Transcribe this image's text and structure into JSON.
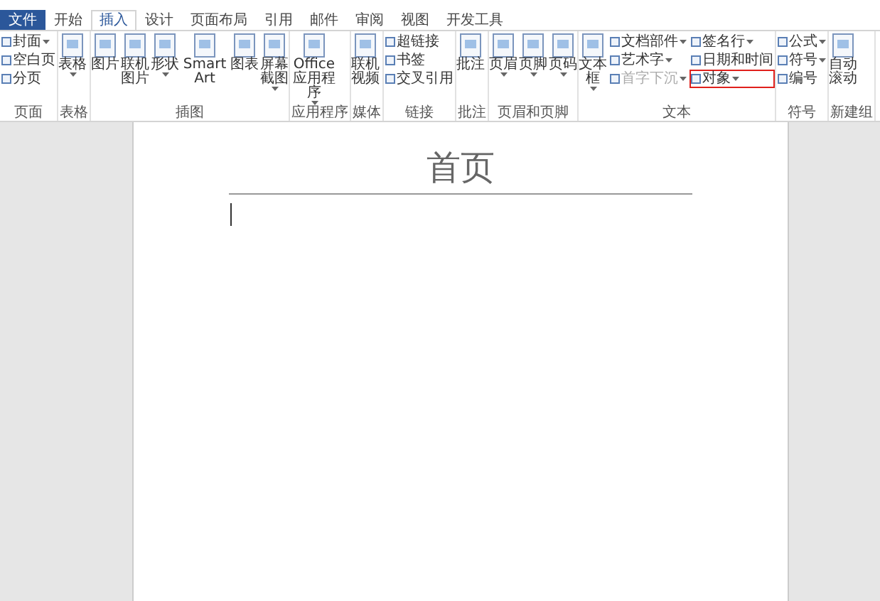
{
  "tabs": [
    {
      "label": "文件",
      "kind": "file",
      "selected": false
    },
    {
      "label": "开始",
      "kind": "tab",
      "selected": false
    },
    {
      "label": "插入",
      "kind": "tab",
      "selected": true
    },
    {
      "label": "设计",
      "kind": "tab",
      "selected": false
    },
    {
      "label": "页面布局",
      "kind": "tab",
      "selected": false
    },
    {
      "label": "引用",
      "kind": "tab",
      "selected": false
    },
    {
      "label": "邮件",
      "kind": "tab",
      "selected": false
    },
    {
      "label": "审阅",
      "kind": "tab",
      "selected": false
    },
    {
      "label": "视图",
      "kind": "tab",
      "selected": false
    },
    {
      "label": "开发工具",
      "kind": "tab",
      "selected": false
    }
  ],
  "groups": [
    {
      "label": "页面",
      "columns": [
        {
          "kind": "stack",
          "items": [
            {
              "label": "封面",
              "dropdown": true,
              "disabled": false,
              "highlighted": false
            },
            {
              "label": "空白页",
              "dropdown": false,
              "disabled": false,
              "highlighted": false
            },
            {
              "label": "分页",
              "dropdown": false,
              "disabled": false,
              "highlighted": false
            }
          ]
        }
      ]
    },
    {
      "label": "表格",
      "columns": [
        {
          "kind": "large",
          "label": "表格",
          "dropdown": true
        }
      ]
    },
    {
      "label": "插图",
      "columns": [
        {
          "kind": "large",
          "label": "图片",
          "dropdown": false
        },
        {
          "kind": "large",
          "label": "联机图片",
          "dropdown": false
        },
        {
          "kind": "large",
          "label": "形状",
          "dropdown": true
        },
        {
          "kind": "large",
          "label": "SmartArt",
          "dropdown": false
        },
        {
          "kind": "large",
          "label": "图表",
          "dropdown": false
        },
        {
          "kind": "large",
          "label": "屏幕截图",
          "dropdown": true
        }
      ]
    },
    {
      "label": "应用程序",
      "columns": [
        {
          "kind": "large",
          "label": "Office 应用程序",
          "dropdown": true
        }
      ]
    },
    {
      "label": "媒体",
      "columns": [
        {
          "kind": "large",
          "label": "联机视频",
          "dropdown": false
        }
      ]
    },
    {
      "label": "链接",
      "columns": [
        {
          "kind": "stack",
          "items": [
            {
              "label": "超链接",
              "dropdown": false,
              "disabled": false,
              "highlighted": false
            },
            {
              "label": "书签",
              "dropdown": false,
              "disabled": false,
              "highlighted": false
            },
            {
              "label": "交叉引用",
              "dropdown": false,
              "disabled": false,
              "highlighted": false
            }
          ]
        }
      ]
    },
    {
      "label": "批注",
      "columns": [
        {
          "kind": "large",
          "label": "批注",
          "dropdown": false
        }
      ]
    },
    {
      "label": "页眉和页脚",
      "columns": [
        {
          "kind": "large",
          "label": "页眉",
          "dropdown": true
        },
        {
          "kind": "large",
          "label": "页脚",
          "dropdown": true
        },
        {
          "kind": "large",
          "label": "页码",
          "dropdown": true
        }
      ]
    },
    {
      "label": "文本",
      "columns": [
        {
          "kind": "large",
          "label": "文本框",
          "dropdown": true
        },
        {
          "kind": "stack",
          "items": [
            {
              "label": "文档部件",
              "dropdown": true,
              "disabled": false,
              "highlighted": false
            },
            {
              "label": "艺术字",
              "dropdown": true,
              "disabled": false,
              "highlighted": false
            },
            {
              "label": "首字下沉",
              "dropdown": true,
              "disabled": true,
              "highlighted": false
            }
          ]
        },
        {
          "kind": "stack",
          "items": [
            {
              "label": "签名行",
              "dropdown": true,
              "disabled": false,
              "highlighted": false
            },
            {
              "label": "日期和时间",
              "dropdown": false,
              "disabled": false,
              "highlighted": false
            },
            {
              "label": "对象",
              "dropdown": true,
              "disabled": false,
              "highlighted": true
            }
          ]
        }
      ]
    },
    {
      "label": "符号",
      "columns": [
        {
          "kind": "stack",
          "items": [
            {
              "label": "公式",
              "dropdown": true,
              "disabled": false,
              "highlighted": false
            },
            {
              "label": "符号",
              "dropdown": true,
              "disabled": false,
              "highlighted": false
            },
            {
              "label": "编号",
              "dropdown": false,
              "disabled": false,
              "highlighted": false
            }
          ]
        }
      ]
    },
    {
      "label": "新建组",
      "columns": [
        {
          "kind": "large",
          "label": "自动滚动",
          "dropdown": false
        }
      ]
    }
  ],
  "document": {
    "header_text": "首页"
  }
}
